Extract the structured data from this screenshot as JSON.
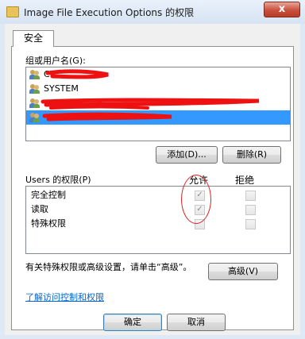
{
  "window": {
    "title": "Image File Execution Options 的权限",
    "close_label": "x"
  },
  "tab": {
    "label": "安全"
  },
  "groups": {
    "label": "组或用户名(G):",
    "items": [
      {
        "name": "Cr"
      },
      {
        "name": "SYSTEM"
      },
      {
        "name": ""
      },
      {
        "name": ""
      }
    ],
    "add_button": "添加(D)...",
    "remove_button": "删除(R)"
  },
  "permissions": {
    "label": "Users 的权限(P)",
    "allow_header": "允许",
    "deny_header": "拒绝",
    "rows": [
      {
        "name": "完全控制",
        "allow": true,
        "deny": false
      },
      {
        "name": "读取",
        "allow": true,
        "deny": false
      },
      {
        "name": "特殊权限",
        "allow": false,
        "deny": false
      }
    ]
  },
  "advanced": {
    "text": "有关特殊权限或高级设置，请单击“高级”。",
    "button": "高级(V)"
  },
  "learn_link": "了解访问控制和权限",
  "ok_button": "确定",
  "cancel_button": "取消"
}
